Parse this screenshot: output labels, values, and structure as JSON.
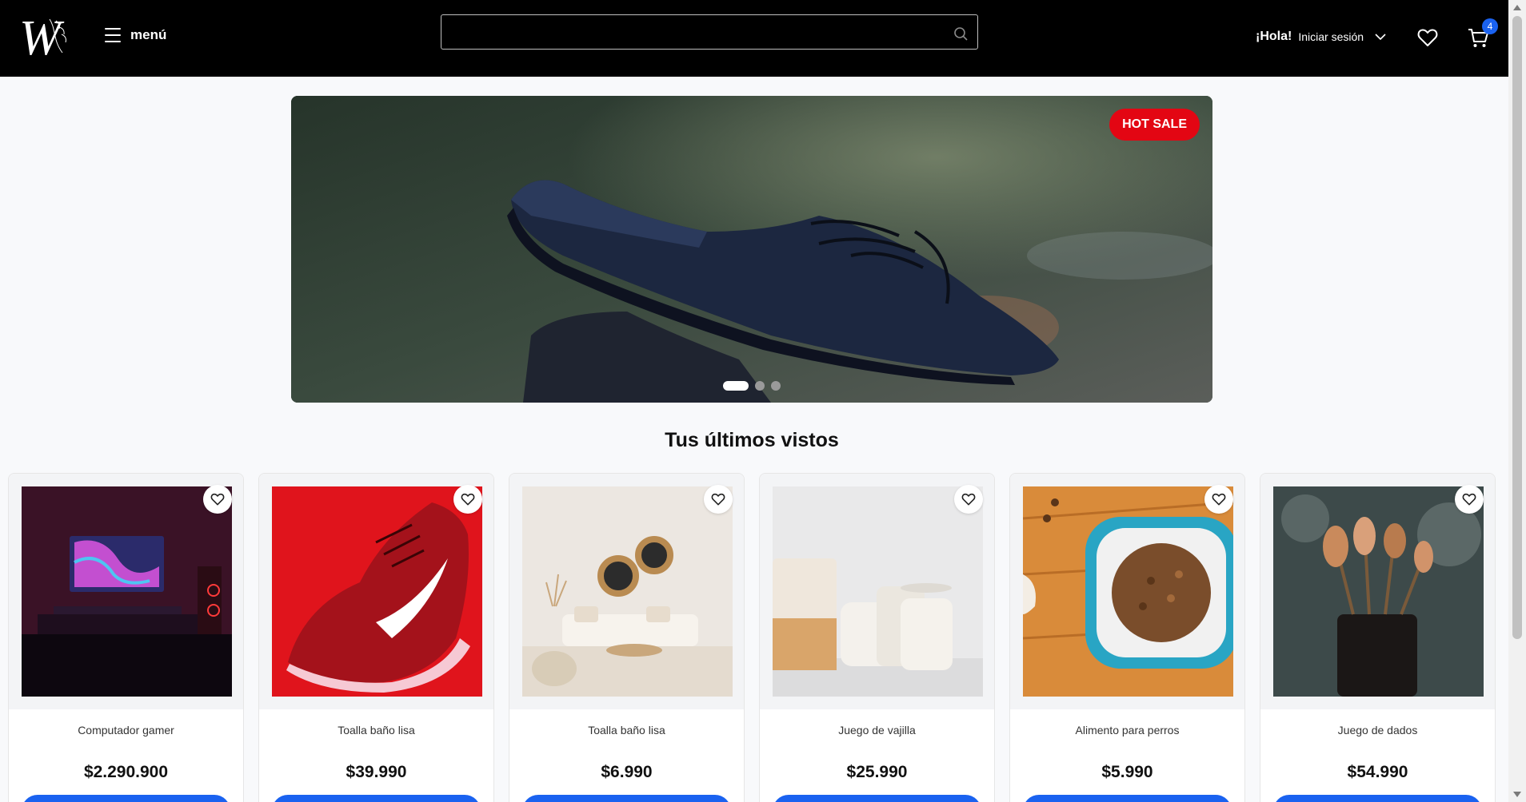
{
  "header": {
    "logo_letter": "W",
    "menu_label": "menú",
    "search": {
      "value": "",
      "placeholder": ""
    },
    "greeting": "¡Hola!",
    "login_label": "Iniciar sesión",
    "cart_count": "4"
  },
  "hero": {
    "badge": "HOT SALE",
    "slides": 3,
    "active_slide": 1
  },
  "section_title": "Tus últimos vistos",
  "products": [
    {
      "name": "Computador gamer",
      "price": "$2.290.900"
    },
    {
      "name": "Toalla baño lisa",
      "price": "$39.990"
    },
    {
      "name": "Toalla baño lisa",
      "price": "$6.990"
    },
    {
      "name": "Juego de vajilla",
      "price": "$25.990"
    },
    {
      "name": "Alimento para perros",
      "price": "$5.990"
    },
    {
      "name": "Juego de dados",
      "price": "$54.990"
    }
  ],
  "colors": {
    "header_bg": "#000000",
    "accent_blue": "#1a62f0",
    "hot_sale_red": "#e30613"
  }
}
